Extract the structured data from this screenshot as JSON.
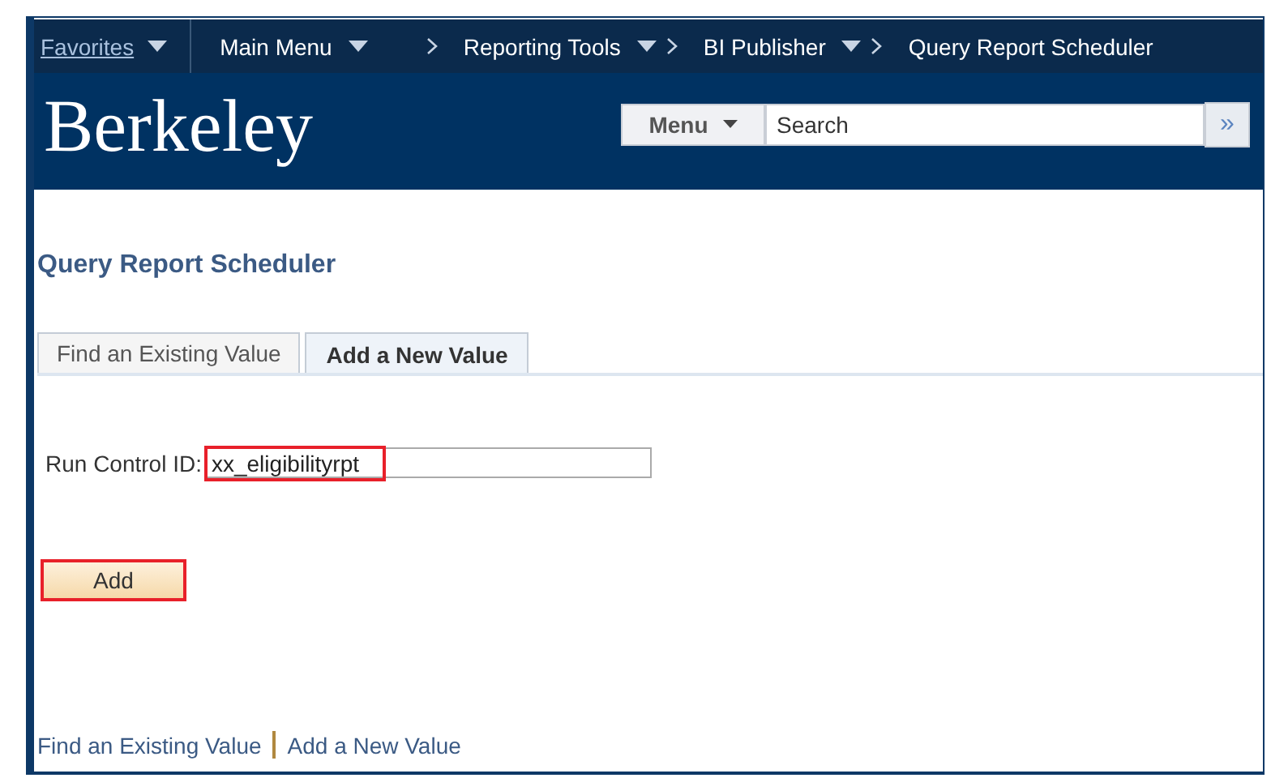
{
  "nav": {
    "favorites": "Favorites",
    "crumbs": [
      {
        "label": "Main Menu",
        "dropdown": true
      },
      {
        "label": "Reporting Tools",
        "dropdown": true
      },
      {
        "label": "BI Publisher",
        "dropdown": true
      },
      {
        "label": "Query Report Scheduler",
        "dropdown": false
      }
    ]
  },
  "header": {
    "logo": "Berkeley",
    "menu": "Menu",
    "search_placeholder": "Search",
    "go": "»"
  },
  "page_title": "Query Report Scheduler",
  "tabs": [
    {
      "label": "Find an Existing Value",
      "selected": false
    },
    {
      "label": "Add a New Value",
      "selected": true
    }
  ],
  "field": {
    "label": "Run Control ID:",
    "value": "xx_eligibilityrpt",
    "highlighted": true
  },
  "add_button": {
    "label": "Add",
    "highlighted": true
  },
  "footer_links": [
    "Find an Existing Value",
    "Add a New Value"
  ]
}
